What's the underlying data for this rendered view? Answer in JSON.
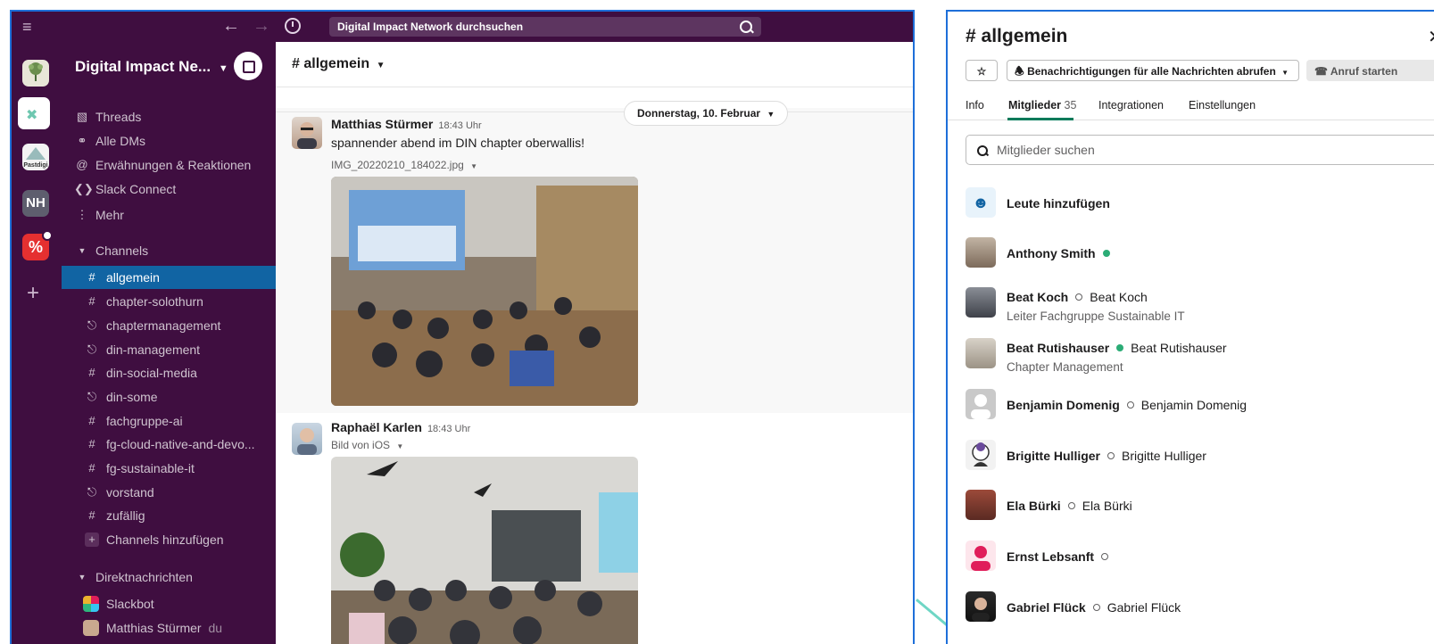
{
  "search": {
    "placeholder": "Digital Impact Network durchsuchen"
  },
  "sidebar": {
    "workspace_name": "Digital Impact Ne...",
    "nav": [
      {
        "icon": "threads-icon",
        "label": "Threads"
      },
      {
        "icon": "dms-icon",
        "label": "Alle DMs"
      },
      {
        "icon": "at-icon",
        "label": "Erwähnungen & Reaktionen"
      },
      {
        "icon": "slack-connect-icon",
        "label": "Slack Connect"
      },
      {
        "icon": "more-icon",
        "label": "Mehr"
      }
    ],
    "channels_header": "Channels",
    "channels": [
      {
        "prefix": "#",
        "label": "allgemein",
        "active": true
      },
      {
        "prefix": "#",
        "label": "chapter-solothurn"
      },
      {
        "prefix": "lock",
        "label": "chaptermanagement"
      },
      {
        "prefix": "lock",
        "label": "din-management"
      },
      {
        "prefix": "#",
        "label": "din-social-media"
      },
      {
        "prefix": "lock",
        "label": "din-some"
      },
      {
        "prefix": "#",
        "label": "fachgruppe-ai"
      },
      {
        "prefix": "#",
        "label": "fg-cloud-native-and-devo..."
      },
      {
        "prefix": "#",
        "label": "fg-sustainable-it"
      },
      {
        "prefix": "lock",
        "label": "vorstand"
      },
      {
        "prefix": "#",
        "label": "zufällig"
      }
    ],
    "add_channels": "Channels hinzufügen",
    "dm_header": "Direktnachrichten",
    "dms": [
      {
        "label": "Slackbot",
        "suffix": ""
      },
      {
        "label": "Matthias Stürmer",
        "suffix": "du"
      }
    ]
  },
  "rail": {
    "workspace_nh": "NH",
    "pastdigi": "Pastdigi",
    "percent": "%"
  },
  "channel": {
    "title": "# allgemein",
    "date_pill": "Donnerstag, 10. Februar",
    "messages": [
      {
        "author": "Matthias Stürmer",
        "time": "18:43 Uhr",
        "text": "spannender abend im DIN chapter oberwallis!",
        "file": "IMG_20220210_184022.jpg"
      },
      {
        "author": "Raphaël Karlen",
        "time": "18:43 Uhr",
        "text": "",
        "file": "Bild von iOS"
      }
    ]
  },
  "panel": {
    "title": "# allgemein",
    "notify_btn": "Benachrichtigungen für alle Nachrichten abrufen",
    "call_btn": "Anruf starten",
    "tabs": [
      {
        "label": "Info"
      },
      {
        "label": "Mitglieder",
        "count": "35",
        "active": true
      },
      {
        "label": "Integrationen"
      },
      {
        "label": "Einstellungen"
      }
    ],
    "member_search_placeholder": "Mitglieder suchen",
    "add_people": "Leute hinzufügen",
    "members": [
      {
        "name": "Anthony Smith",
        "status": "online",
        "display": "",
        "title": ""
      },
      {
        "name": "Beat Koch",
        "status": "away",
        "display": "Beat Koch",
        "title": "Leiter Fachgruppe Sustainable IT"
      },
      {
        "name": "Beat Rutishauser",
        "status": "online",
        "display": "Beat Rutishauser",
        "title": "Chapter Management"
      },
      {
        "name": "Benjamin Domenig",
        "status": "away",
        "display": "Benjamin Domenig",
        "title": ""
      },
      {
        "name": "Brigitte Hulliger",
        "status": "away",
        "display": "Brigitte Hulliger",
        "title": ""
      },
      {
        "name": "Ela Bürki",
        "status": "away",
        "display": "Ela Bürki",
        "title": ""
      },
      {
        "name": "Ernst Lebsanft",
        "status": "away",
        "display": "",
        "title": ""
      },
      {
        "name": "Gabriel Flück",
        "status": "away",
        "display": "Gabriel Flück",
        "title": ""
      }
    ]
  },
  "colors": {
    "aubergine": "#3f0e40",
    "active": "#1164a3",
    "online": "#2bac76",
    "tab_underline": "#007a5a",
    "frame": "#1e6fd9"
  }
}
